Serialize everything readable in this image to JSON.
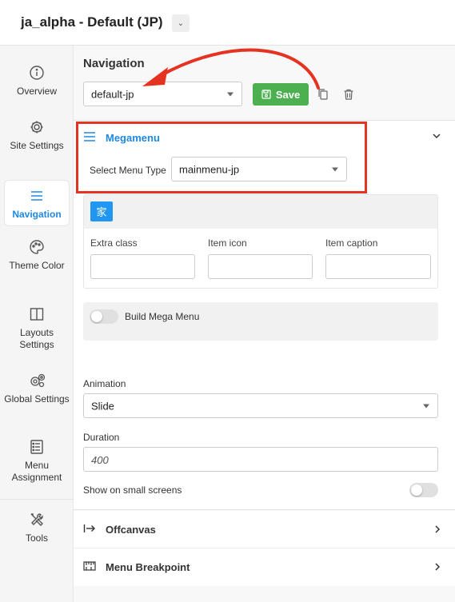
{
  "header": {
    "title": "ja_alpha - Default (JP)"
  },
  "sidebar": {
    "items": [
      {
        "label": "Overview"
      },
      {
        "label": "Site Settings"
      },
      {
        "label": "Navigation"
      },
      {
        "label": "Theme Color"
      },
      {
        "label": "Layouts Settings"
      },
      {
        "label": "Global Settings"
      },
      {
        "label": "Menu Assignment"
      },
      {
        "label": "Tools"
      }
    ],
    "active_index": 2
  },
  "main": {
    "heading": "Navigation",
    "navigation_select": {
      "value": "default-jp"
    },
    "save_label": "Save",
    "megamenu": {
      "title": "Megamenu",
      "select_menu_type_label": "Select Menu Type",
      "menu_type_value": "mainmenu-jp",
      "item": {
        "icon_glyph": "家",
        "fields": [
          "Extra class",
          "Item icon",
          "Item caption"
        ]
      },
      "build_mega_menu_label": "Build Mega Menu",
      "build_mega_menu_on": false,
      "animation_label": "Animation",
      "animation_value": "Slide",
      "duration_label": "Duration",
      "duration_placeholder": "400",
      "small_screens_label": "Show on small screens",
      "small_screens_on": false
    },
    "offcanvas_label": "Offcanvas",
    "breakpoint_label": "Menu Breakpoint"
  },
  "colors": {
    "accent": "#1e88e5",
    "save_green": "#4caf50",
    "annotation_red": "#e53321"
  }
}
